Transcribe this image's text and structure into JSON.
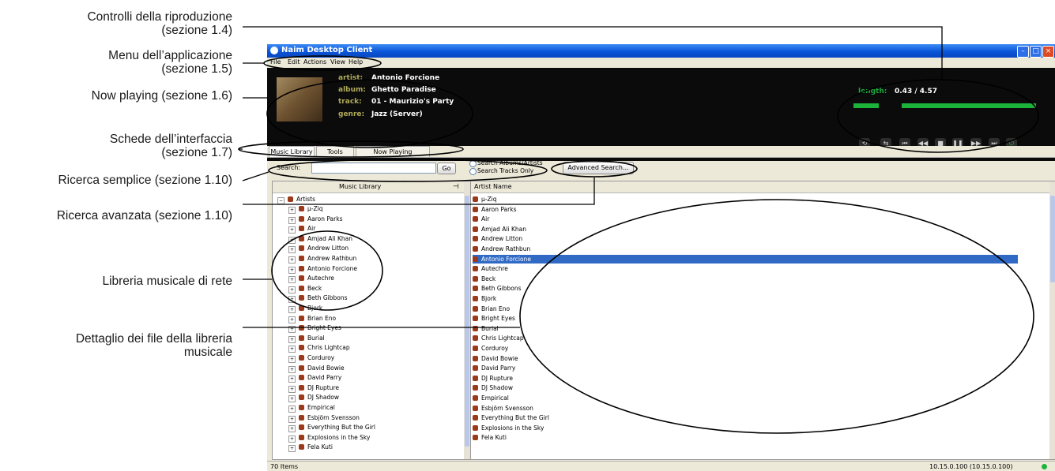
{
  "callouts": {
    "controls": {
      "line1": "Controlli della riproduzione",
      "line2": "(sezione 1.4)"
    },
    "menu": {
      "line1": "Menu dell’applicazione",
      "line2": "(sezione 1.5)"
    },
    "now_playing": {
      "line1": "Now playing (sezione 1.6)"
    },
    "tabs": {
      "line1": "Schede dell’interfaccia",
      "line2": "(sezione 1.7)"
    },
    "simple_search": {
      "line1": "Ricerca semplice (sezione 1.10)"
    },
    "advanced_search": {
      "line1": "Ricerca avanzata (sezione 1.10)"
    },
    "library": {
      "line1": "Libreria musicale di rete"
    },
    "detail": {
      "line1": "Dettaglio dei file della libreria",
      "line2": "musicale"
    }
  },
  "window": {
    "title": "Naim Desktop Client"
  },
  "menu": {
    "items": [
      "File",
      "Edit",
      "Actions",
      "View",
      "Help"
    ]
  },
  "now_playing": {
    "artist_label": "artist:",
    "artist": "Antonio Forcione",
    "album_label": "album:",
    "album": "Ghetto Paradise",
    "track_label": "track:",
    "track": "01 - Maurizio's Party",
    "genre_label": "genre:",
    "genre": "Jazz (Server)",
    "length_label": "length:",
    "length": "0.43 / 4.57",
    "progress": 0.08,
    "volume": 0.85,
    "accent_color": "#1bb33a"
  },
  "transport": {
    "icons": [
      "repeat-icon",
      "shuffle-icon",
      "skip-back-icon",
      "rewind-icon",
      "stop-icon",
      "pause-icon",
      "fast-forward-icon",
      "skip-forward-icon",
      "power-icon"
    ]
  },
  "tabs": [
    "Music Library",
    "Tools",
    "Now Playing"
  ],
  "search": {
    "label": "Search:",
    "go": "Go",
    "option_albums": "Search Albums/Artists",
    "option_tracks": "Search Tracks Only",
    "advanced": "Advanced Search..."
  },
  "library": {
    "header": "Music Library",
    "root": "Artists",
    "items": [
      "µ-Ziq",
      "Aaron Parks",
      "Air",
      "Amjad Ali Khan",
      "Andrew Litton",
      "Andrew Rathbun",
      "Antonio Forcione",
      "Autechre",
      "Beck",
      "Beth Gibbons",
      "Bjork",
      "Brian Eno",
      "Bright Eyes",
      "Burial",
      "Chris Lightcap",
      "Corduroy",
      "David Bowie",
      "David Parry",
      "DJ Rupture",
      "DJ Shadow",
      "Empirical",
      "Esbjörn Svensson",
      "Everything But the Girl",
      "Explosions in the Sky",
      "Fela Kuti"
    ]
  },
  "detail": {
    "header": "Artist Name",
    "selected": "Antonio Forcione",
    "selection_color": "#316ac5",
    "items": [
      "µ-Ziq",
      "Aaron Parks",
      "Air",
      "Amjad Ali Khan",
      "Andrew Litton",
      "Andrew Rathbun",
      "Antonio Forcione",
      "Autechre",
      "Beck",
      "Beth Gibbons",
      "Bjork",
      "Brian Eno",
      "Bright Eyes",
      "Burial",
      "Chris Lightcap",
      "Corduroy",
      "David Bowie",
      "David Parry",
      "DJ Rupture",
      "DJ Shadow",
      "Empirical",
      "Esbjörn Svensson",
      "Everything But the Girl",
      "Explosions in the Sky",
      "Fela Kuti"
    ]
  },
  "status": {
    "items": "70 Items",
    "server": "10.15.0.100 (10.15.0.100)"
  }
}
